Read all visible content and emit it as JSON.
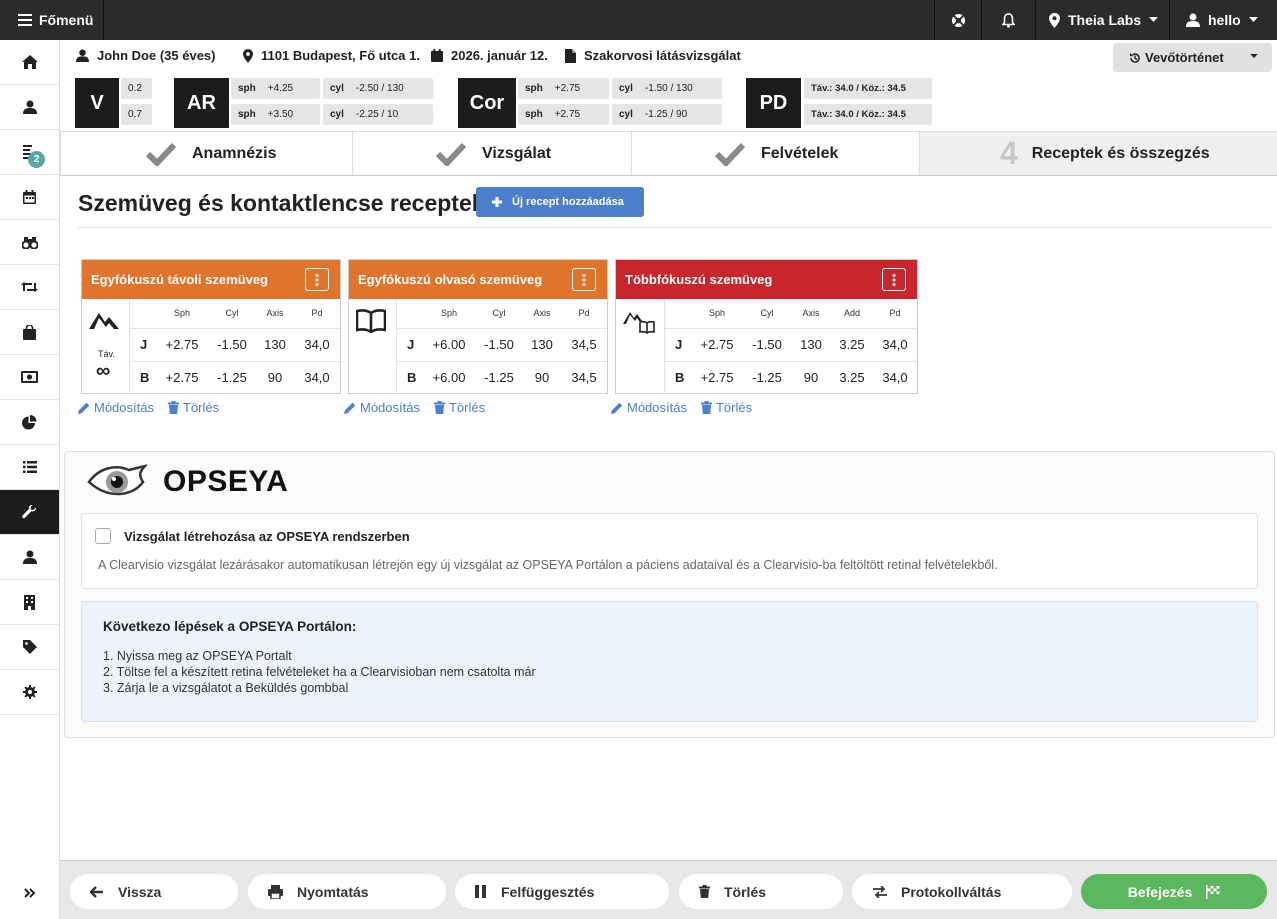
{
  "topbar": {
    "menu_label": "Főmenü",
    "location": "Theia Labs",
    "user": "hello"
  },
  "sidebar": {
    "items": [
      {
        "icon": "home-icon"
      },
      {
        "icon": "user-icon"
      },
      {
        "icon": "list-numbered-icon",
        "badge": "2"
      },
      {
        "icon": "calendar-icon"
      },
      {
        "icon": "binoculars-icon"
      },
      {
        "icon": "retweet-icon"
      },
      {
        "icon": "shopping-bag-icon"
      },
      {
        "icon": "money-icon"
      },
      {
        "icon": "pie-chart-icon"
      },
      {
        "icon": "list-icon"
      },
      {
        "icon": "wrench-icon"
      },
      {
        "icon": "user-icon"
      },
      {
        "icon": "building-icon"
      },
      {
        "icon": "tag-icon"
      },
      {
        "icon": "gear-icon"
      }
    ]
  },
  "patient": {
    "name": "John Doe (35 éves)",
    "address": "1101 Budapest, Fő utca 1.",
    "date": "2026. január 12.",
    "exam_type": "Szakorvosi látásvizsgálat",
    "history_button": "Vevőtörténet"
  },
  "measurements": {
    "v": {
      "label": "V",
      "values": [
        "0.2",
        "0.7"
      ]
    },
    "ar": {
      "label": "AR",
      "rows": [
        {
          "sph_label": "sph",
          "sph": "+4.25",
          "cyl_label": "cyl",
          "cyl": "-2.50 / 130"
        },
        {
          "sph_label": "sph",
          "sph": "+3.50",
          "cyl_label": "cyl",
          "cyl": "-2.25 / 10"
        }
      ]
    },
    "cor": {
      "label": "Cor",
      "rows": [
        {
          "sph_label": "sph",
          "sph": "+2.75",
          "cyl_label": "cyl",
          "cyl": "-1.50 / 130"
        },
        {
          "sph_label": "sph",
          "sph": "+2.75",
          "cyl_label": "cyl",
          "cyl": "-1.25 / 90"
        }
      ]
    },
    "pd": {
      "label": "PD",
      "values": [
        "Táv.: 34.0 / Köz.: 34.5",
        "Táv.: 34.0 / Köz.: 34.5"
      ]
    }
  },
  "steps": [
    {
      "label": "Anamnézis",
      "done": true
    },
    {
      "label": "Vizsgálat",
      "done": true
    },
    {
      "label": "Felvételek",
      "done": true
    },
    {
      "number": "4",
      "label": "Receptek és összegzés",
      "done": false
    }
  ],
  "recipes": {
    "title": "Szemüveg és kontaktlencse receptek",
    "add_button": "Új recept hozzáadása",
    "edit_label": "Módosítás",
    "delete_label": "Törlés",
    "cards": [
      {
        "title": "Egyfókuszú távoli szemüveg",
        "color": "#e0742b",
        "icon_label": "Táv.",
        "icon_symbol": "∞",
        "headers": [
          "Sph",
          "Cyl",
          "Axis",
          "Pd"
        ],
        "rows": [
          {
            "side": "J",
            "values": [
              "+2.75",
              "-1.50",
              "130",
              "34,0"
            ]
          },
          {
            "side": "B",
            "values": [
              "+2.75",
              "-1.25",
              "90",
              "34,0"
            ]
          }
        ]
      },
      {
        "title": "Egyfókuszú olvasó szemüveg",
        "color": "#e0742b",
        "headers": [
          "Sph",
          "Cyl",
          "Axis",
          "Pd"
        ],
        "rows": [
          {
            "side": "J",
            "values": [
              "+6.00",
              "-1.50",
              "130",
              "34,5"
            ]
          },
          {
            "side": "B",
            "values": [
              "+6.00",
              "-1.25",
              "90",
              "34,5"
            ]
          }
        ]
      },
      {
        "title": "Többfókuszú szemüveg",
        "color": "#c9252c",
        "headers": [
          "Sph",
          "Cyl",
          "Axis",
          "Add",
          "Pd"
        ],
        "rows": [
          {
            "side": "J",
            "values": [
              "+2.75",
              "-1.50",
              "130",
              "3.25",
              "34,0"
            ]
          },
          {
            "side": "B",
            "values": [
              "+2.75",
              "-1.25",
              "90",
              "3.25",
              "34,0"
            ]
          }
        ]
      }
    ]
  },
  "opseya": {
    "brand": "OPSEYA",
    "checkbox_label": "Vizsgálat létrehozása az OPSEYA rendszerben",
    "checked": false,
    "description": "A Clearvisio vizsgálat lezárásakor automatikusan létrejön egy új vizsgálat az OPSEYA Portálon a páciens adataival és a Clearvisio-ba feltöltött retinal felvételekből.",
    "next_steps_title": "Következo lépések a OPSEYA Portálon:",
    "next_steps": [
      "1. Nyissa meg az OPSEYA Portalt",
      "2. Töltse fel a készített retina felvételeket ha a Clearvisioban nem csatolta már",
      "3. Zárja le a vizsgálatot a Beküldés gombbal"
    ]
  },
  "bottombar": {
    "back": "Vissza",
    "print": "Nyomtatás",
    "suspend": "Felfüggesztés",
    "delete": "Törlés",
    "protocol": "Protokollváltás",
    "finish": "Befejezés"
  }
}
